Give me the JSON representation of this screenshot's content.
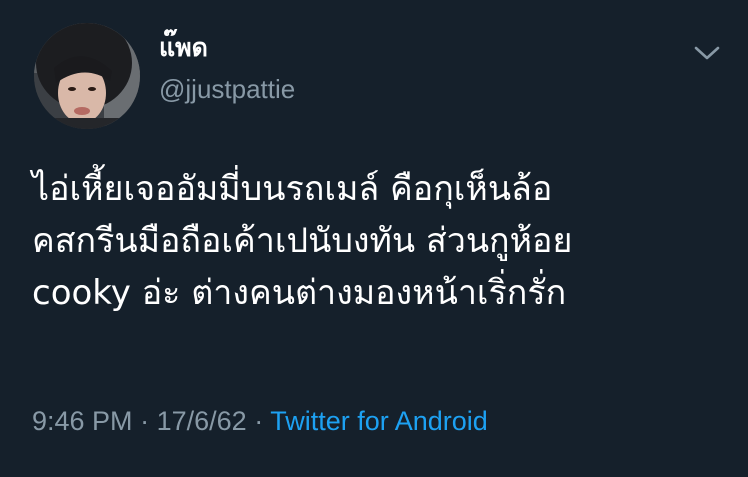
{
  "user": {
    "display_name": "แ๊พด",
    "handle": "@jjustpattie"
  },
  "tweet": {
    "lines": [
      "ไอ่เหี้ยเจออัมมี่บนรถเมล์ คือกุเห็นล้อ",
      "คสกรีนมือถือเค้าเปนับงทัน ส่วนกูห้อย",
      "cooky อ่ะ ต่างคนต่างมองหน้าเริ่กรั่ก"
    ]
  },
  "meta": {
    "time": "9:46 PM",
    "separator": "·",
    "date": "17/6/62",
    "source": "Twitter for Android"
  },
  "icons": {
    "menu": "chevron-down-icon"
  },
  "colors": {
    "background": "#15202b",
    "secondary_text": "#8899a6",
    "link": "#1da1f2"
  }
}
